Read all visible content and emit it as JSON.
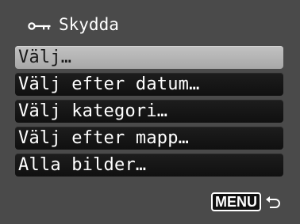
{
  "header": {
    "icon": "key-icon",
    "title": "Skydda"
  },
  "menu": {
    "selected_index": 0,
    "items": [
      {
        "label": "Välj…"
      },
      {
        "label": "Välj efter datum…"
      },
      {
        "label": "Välj kategori…"
      },
      {
        "label": "Välj efter mapp…"
      },
      {
        "label": "Alla bilder…"
      }
    ]
  },
  "footer": {
    "menu_label": "MENU",
    "back_icon": "return-arrow-icon"
  },
  "colors": {
    "background": "#4a4a4a",
    "item_background": "#151515",
    "selected_background": "#b8b8b8",
    "text": "#ffffff",
    "selected_text": "#1a1a1a"
  }
}
